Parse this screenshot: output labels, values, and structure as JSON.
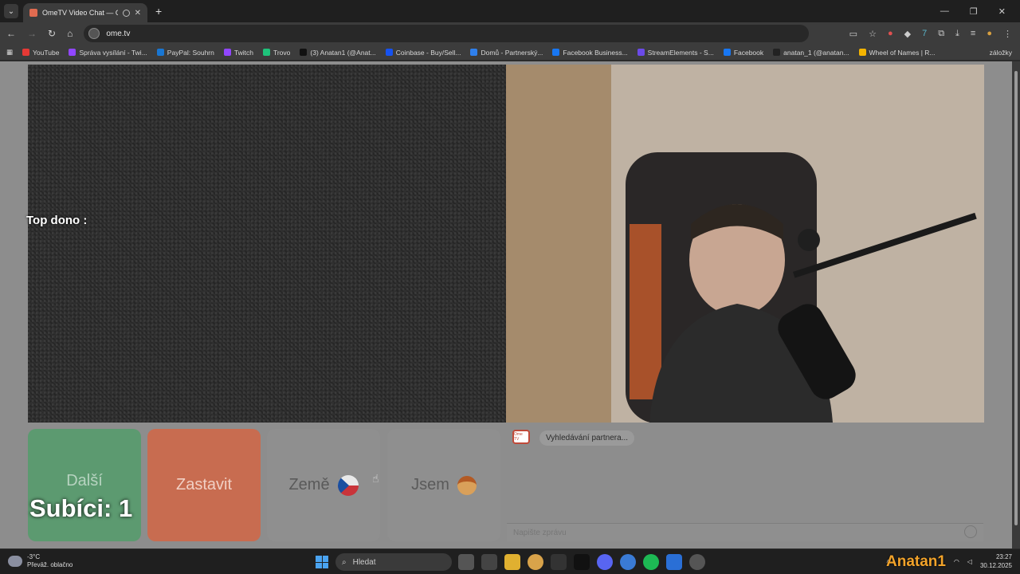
{
  "browser": {
    "tab_title": "OmeTV Video Chat — Ome",
    "url": "ome.tv",
    "bookmarks": [
      {
        "label": "YouTube",
        "color": "#e53935"
      },
      {
        "label": "Správa vysílání - Twi...",
        "color": "#9146ff"
      },
      {
        "label": "PayPal: Souhrn",
        "color": "#1976d2"
      },
      {
        "label": "Twitch",
        "color": "#9146ff"
      },
      {
        "label": "Trovo",
        "color": "#1ec27a"
      },
      {
        "label": "(3) Anatan1 (@Anat...",
        "color": "#111111"
      },
      {
        "label": "Coinbase - Buy/Sell...",
        "color": "#1652f0"
      },
      {
        "label": "Domů - Partnerský...",
        "color": "#2f80ed"
      },
      {
        "label": "Facebook Business...",
        "color": "#1877f2"
      },
      {
        "label": "StreamElements - S...",
        "color": "#6b4ae8"
      },
      {
        "label": "Facebook",
        "color": "#1877f2"
      },
      {
        "label": "anatan_1 (@anatan...",
        "color": "#222222"
      },
      {
        "label": "Wheel of Names | R...",
        "color": "#f4b400"
      }
    ],
    "bookmarks_more": "záložky"
  },
  "overlay": {
    "top_dono": "Top dono :",
    "subs": "Subíci: 1",
    "streamer_name": "Anatan1"
  },
  "controls": {
    "next": "Další",
    "stop": "Zastavit",
    "country": "Země",
    "gender": "Jsem"
  },
  "chat": {
    "logo": "Ome TV",
    "status_message": "Vyhledávání partnera...",
    "input_placeholder": "Napište zprávu"
  },
  "taskbar": {
    "temperature": "-3°C",
    "weather": "Převāž. oblačno",
    "search_label": "Hledat",
    "time": "23:27",
    "date": "30.12.2025"
  }
}
